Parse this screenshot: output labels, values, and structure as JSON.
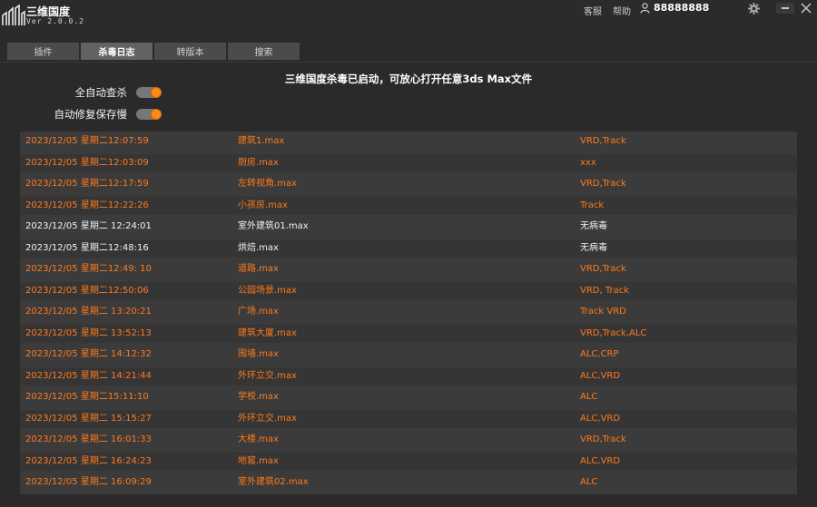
{
  "app": {
    "name": "三维国度",
    "version": "Ver 2.0.0.2"
  },
  "titlebar": {
    "service_label": "客服",
    "help_label": "帮助",
    "username": "88888888"
  },
  "tabs": [
    {
      "label": "插件",
      "active": false
    },
    {
      "label": "杀毒日志",
      "active": true
    },
    {
      "label": "转版本",
      "active": false
    },
    {
      "label": "搜索",
      "active": false
    }
  ],
  "status_message": "三维国度杀毒已启动，可放心打开任意3ds Max文件",
  "toggles": [
    {
      "label": "全自动查杀",
      "on": true
    },
    {
      "label": "自动修复保存慢",
      "on": true
    }
  ],
  "colors": {
    "accent": "#ff8a1c",
    "infected_text": "#ff7a1a",
    "clean_text": "#f2f2f2"
  },
  "log": [
    {
      "time": "2023/12/05 星期二12:07:59",
      "file": "建筑1.max",
      "virus": "VRD,Track",
      "infected": true
    },
    {
      "time": "2023/12/05 星期二12:03:09",
      "file": "厨房.max",
      "virus": "xxx",
      "infected": true
    },
    {
      "time": "2023/12/05 星期二12:17:59",
      "file": "左转视角.max",
      "virus": "VRD,Track",
      "infected": true
    },
    {
      "time": "2023/12/05 星期二12:22:26",
      "file": "小孩房.max",
      "virus": "Track",
      "infected": true
    },
    {
      "time": "2023/12/05 星期二 12:24:01",
      "file": "室外建筑01.max",
      "virus": "无病毒",
      "infected": false
    },
    {
      "time": "2023/12/05 星期二12:48:16",
      "file": "烘焙.max",
      "virus": "无病毒",
      "infected": false
    },
    {
      "time": "2023/12/05 星期二12:49: 10",
      "file": "道路.max",
      "virus": "VRD,Track",
      "infected": true
    },
    {
      "time": "2023/12/05 星期二12:50:06",
      "file": "公园场景.max",
      "virus": "VRD, Track",
      "infected": true
    },
    {
      "time": "2023/12/05 星期二 13:20:21",
      "file": "广场.max",
      "virus": "Track VRD",
      "infected": true
    },
    {
      "time": "2023/12/05 星期二 13:52:13",
      "file": "建筑大厦.max",
      "virus": "VRD,Track,ALC",
      "infected": true
    },
    {
      "time": "2023/12/05 星期二 14:12:32",
      "file": "围墙.max",
      "virus": "ALC,CRP",
      "infected": true
    },
    {
      "time": "2023/12/05 星期二 14:21:44",
      "file": "外环立交.max",
      "virus": "ALC,VRD",
      "infected": true
    },
    {
      "time": "2023/12/05 星期二15:11:10",
      "file": "学校.max",
      "virus": "ALC",
      "infected": true
    },
    {
      "time": "2023/12/05 星期二 15:15:27",
      "file": "外环立交.max",
      "virus": "ALC,VRD",
      "infected": true
    },
    {
      "time": "2023/12/05 星期二 16:01:33",
      "file": "大楼.max",
      "virus": "VRD,Track",
      "infected": true
    },
    {
      "time": "2023/12/05 星期二 16:24:23",
      "file": "地窖.max",
      "virus": "ALC,VRD",
      "infected": true
    },
    {
      "time": "2023/12/05 星期二 16:09:29",
      "file": "室外建筑02.max",
      "virus": "ALC",
      "infected": true
    }
  ]
}
